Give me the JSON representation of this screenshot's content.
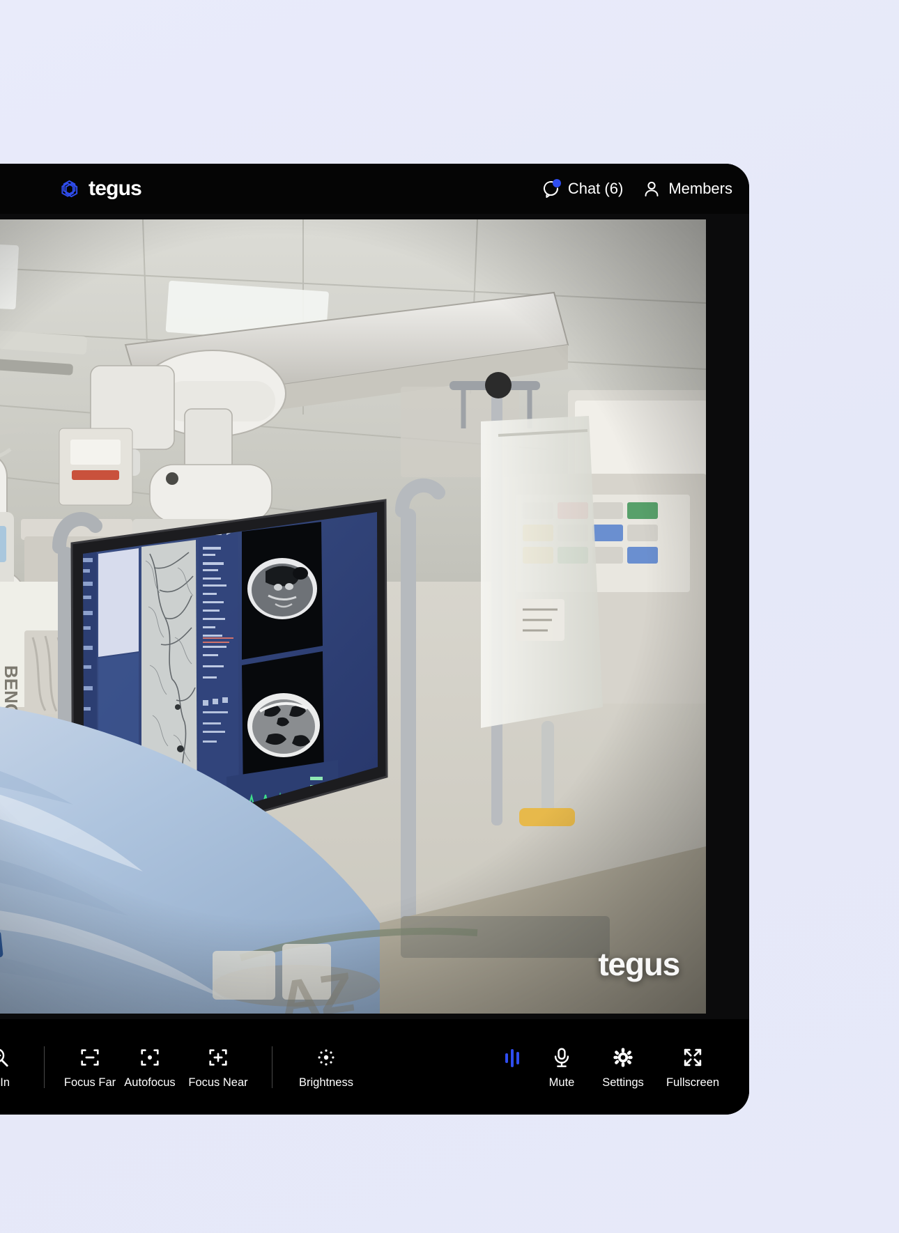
{
  "app": {
    "brand_name": "tegus",
    "background_color": "#e7e9f9",
    "panel_color": "#000000",
    "accent_color": "#2f4df0"
  },
  "header": {
    "logo_icon": "tegus-cube-logo-icon",
    "chat": {
      "label": "Chat (6)",
      "icon": "chat-bubble-icon",
      "unread_badge": true,
      "unread_count": 6
    },
    "members": {
      "label": "Members",
      "icon": "person-icon"
    }
  },
  "video": {
    "watermark": "tegus",
    "scene": "live-operating-room-camera-feed",
    "description": "Catheterization lab live feed: surgical team at draped patient table, ceiling-mounted C-arm imaging gantry, and a large wall monitor displaying angiography runs, two axial CT head slices and a green ECG vitals strip."
  },
  "toolbar": {
    "left_controls": [
      {
        "label": "Zoom In",
        "icon": "magnifier-plus-icon",
        "truncated_label": "m In"
      },
      {
        "label": "Focus Far",
        "icon": "focus-minus-icon"
      },
      {
        "label": "Autofocus",
        "icon": "focus-dot-icon"
      },
      {
        "label": "Focus Near",
        "icon": "focus-plus-icon"
      },
      {
        "label": "Brightness",
        "icon": "brightness-dots-icon"
      }
    ],
    "right_controls": [
      {
        "label": "",
        "icon": "audio-level-meter-icon"
      },
      {
        "label": "Mute",
        "icon": "microphone-icon"
      },
      {
        "label": "Settings",
        "icon": "gear-icon"
      },
      {
        "label": "Fullscreen",
        "icon": "expand-arrows-icon"
      }
    ]
  }
}
